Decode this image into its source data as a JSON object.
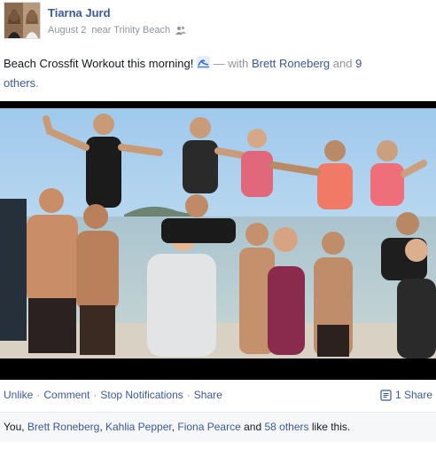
{
  "post": {
    "author": "Tiarna Jurd",
    "date": "August 2",
    "location_text": "near Trinity Beach",
    "status_text": "Beach Crossfit Workout this morning!",
    "with_prefix": "— with",
    "tagged_person": "Brett Roneberg",
    "and_text": "and",
    "others_count": "9",
    "others_label": "others",
    "period": "."
  },
  "actions": {
    "unlike": "Unlike",
    "comment": "Comment",
    "stop_notifications": "Stop Notifications",
    "share": "Share",
    "share_count": "1 Share",
    "separator": "·"
  },
  "likes": {
    "you": "You",
    "person1": "Brett Roneberg",
    "person2": "Kahlia Pepper",
    "person3": "Fiona Pearce",
    "and_text": "and",
    "others": "58 others",
    "suffix": "like this."
  },
  "icons": {
    "activity": "wave-icon",
    "audience": "friends-icon",
    "share": "share-icon"
  },
  "colors": {
    "link": "#3b5998",
    "muted": "#90949c",
    "likes_bg": "#f6f7f9"
  }
}
